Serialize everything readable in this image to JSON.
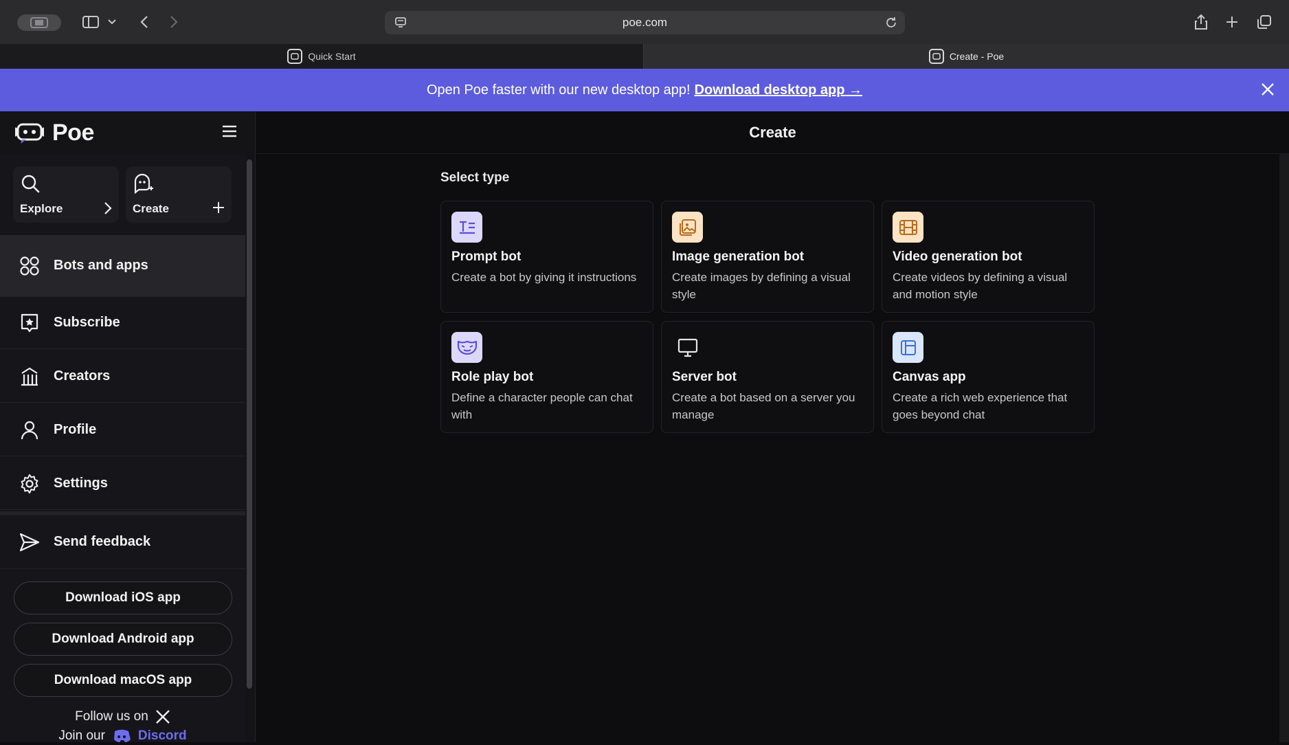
{
  "browser": {
    "url": "poe.com",
    "tabs": [
      {
        "label": "Quick Start"
      },
      {
        "label": "Create - Poe"
      }
    ]
  },
  "banner": {
    "text": "Open Poe faster with our new desktop app!",
    "link": "Download desktop app →"
  },
  "sidebar": {
    "logo": "Poe",
    "quick": [
      {
        "label": "Explore"
      },
      {
        "label": "Create"
      }
    ],
    "nav": [
      {
        "label": "Bots and apps"
      },
      {
        "label": "Subscribe"
      },
      {
        "label": "Creators"
      },
      {
        "label": "Profile"
      },
      {
        "label": "Settings"
      },
      {
        "label": "Send feedback"
      }
    ],
    "downloads": [
      {
        "label": "Download iOS app"
      },
      {
        "label": "Download Android app"
      },
      {
        "label": "Download macOS app"
      }
    ],
    "follow": "Follow us on",
    "join": "Join our",
    "discord": "Discord"
  },
  "main": {
    "title": "Create",
    "section": "Select type",
    "cards": [
      {
        "title": "Prompt bot",
        "desc": "Create a bot by giving it instructions",
        "icon": "prompt-icon"
      },
      {
        "title": "Image generation bot",
        "desc": "Create images by defining a visual style",
        "icon": "image-icon"
      },
      {
        "title": "Video generation bot",
        "desc": "Create videos by defining a visual and motion style",
        "icon": "film-icon"
      },
      {
        "title": "Role play bot",
        "desc": "Define a character people can chat with",
        "icon": "mask-icon"
      },
      {
        "title": "Server bot",
        "desc": "Create a bot based on a server you manage",
        "icon": "monitor-icon"
      },
      {
        "title": "Canvas app",
        "desc": "Create a rich web experience that goes beyond chat",
        "icon": "canvas-icon"
      }
    ]
  },
  "colors": {
    "banner": "#5d5cde",
    "prompt_icon_bg": "#dcd8fb",
    "image_icon_bg": "#fbe3c4",
    "video_icon_bg": "#fbe3c4",
    "roleplay_icon_bg": "#dcd8fb",
    "canvas_icon_bg": "#d9e6fb"
  }
}
